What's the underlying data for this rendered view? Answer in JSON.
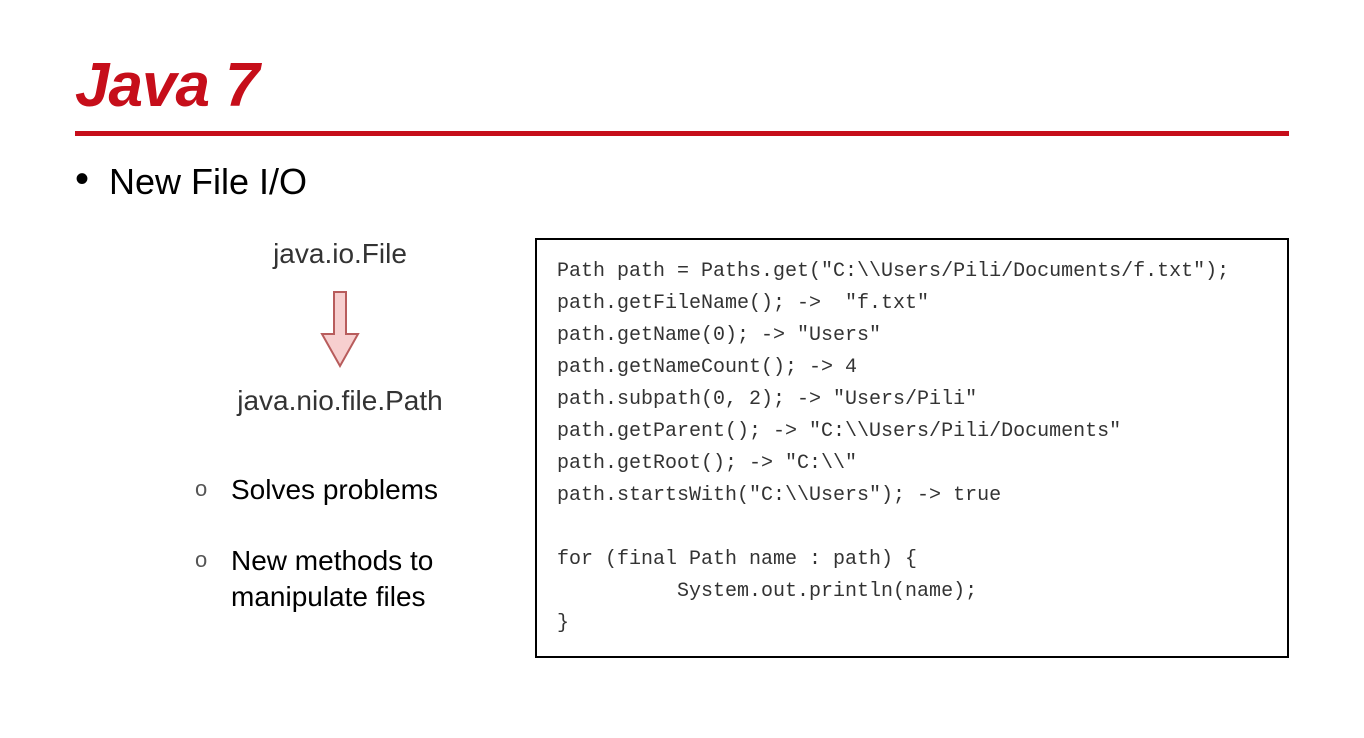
{
  "title": "Java 7",
  "bullet": "New File I/O",
  "left": {
    "old_class": "java.io.File",
    "new_class": "java.nio.file.Path",
    "sub_items": [
      "Solves problems",
      "New methods to manipulate files"
    ]
  },
  "code": "Path path = Paths.get(\"C:\\\\Users/Pili/Documents/f.txt\");\npath.getFileName(); ->  \"f.txt\"\npath.getName(0); -> \"Users\"\npath.getNameCount(); -> 4\npath.subpath(0, 2); -> \"Users/Pili\"\npath.getParent(); -> \"C:\\\\Users/Pili/Documents\"\npath.getRoot(); -> \"C:\\\\\"\npath.startsWith(\"C:\\\\Users\"); -> true\n\nfor (final Path name : path) {\n          System.out.println(name);\n}"
}
